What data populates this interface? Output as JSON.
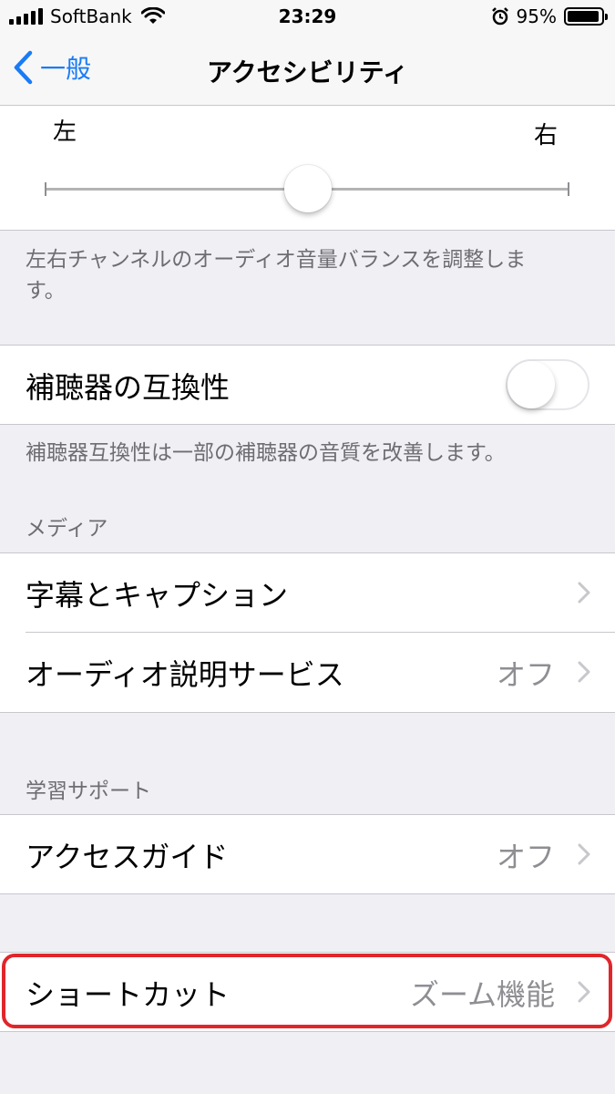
{
  "status_bar": {
    "carrier": "SoftBank",
    "time": "23:29",
    "battery_percent": "95%",
    "battery_level": 0.95,
    "icons": [
      "signal-icon",
      "wifi-icon",
      "alarm-icon",
      "battery-icon"
    ]
  },
  "nav": {
    "back_label": "一般",
    "title": "アクセシビリティ"
  },
  "balance": {
    "left_label": "左",
    "right_label": "右",
    "value": 0.5,
    "footer": "左右チャンネルのオーディオ音量バランスを調整します。"
  },
  "hearing_aid": {
    "label": "補聴器の互換性",
    "enabled": false,
    "footer": "補聴器互換性は一部の補聴器の音質を改善します。"
  },
  "media": {
    "header": "メディア",
    "items": [
      {
        "label": "字幕とキャプション",
        "value": ""
      },
      {
        "label": "オーディオ説明サービス",
        "value": "オフ"
      }
    ]
  },
  "learning": {
    "header": "学習サポート",
    "items": [
      {
        "label": "アクセスガイド",
        "value": "オフ"
      }
    ]
  },
  "shortcut": {
    "label": "ショートカット",
    "value": "ズーム機能"
  },
  "colors": {
    "accent": "#1a7bf6",
    "highlight": "#e0262b",
    "background": "#efeff4",
    "secondary_text": "#8e8e93"
  }
}
